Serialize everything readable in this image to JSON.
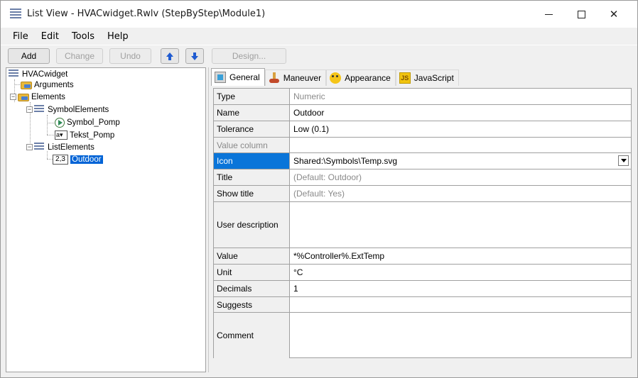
{
  "window": {
    "title": "List View - HVACwidget.Rwlv (StepByStep\\Module1)",
    "minimize_glyph": "—",
    "maximize_glyph": "☐",
    "close_glyph": "✕"
  },
  "menu": {
    "items": [
      {
        "label": "File"
      },
      {
        "label": "Edit"
      },
      {
        "label": "Tools"
      },
      {
        "label": "Help"
      }
    ]
  },
  "toolbar": {
    "add": "Add",
    "change": "Change",
    "undo": "Undo",
    "design": "Design...",
    "move_up_icon": "arrow-up-icon",
    "move_down_icon": "arrow-down-icon"
  },
  "tree": {
    "root": "HVACwidget",
    "arguments": "Arguments",
    "elements": "Elements",
    "symbol_elements": "SymbolElements",
    "symbol_pomp": "Symbol_Pomp",
    "tekst_pomp": "Tekst_Pomp",
    "list_elements": "ListElements",
    "outdoor": "Outdoor",
    "num_icon_text": "2,3",
    "textbox_icon_text": "a▾",
    "expander_minus": "−"
  },
  "tabs": [
    {
      "label": "General",
      "icon": "general-icon",
      "active": true
    },
    {
      "label": "Maneuver",
      "icon": "maneuver-icon",
      "active": false
    },
    {
      "label": "Appearance",
      "icon": "appearance-icon",
      "active": false
    },
    {
      "label": "JavaScript",
      "icon": "javascript-icon",
      "active": false
    }
  ],
  "properties": [
    {
      "key": "Type",
      "value": "Numeric",
      "value_grey": true
    },
    {
      "key": "Name",
      "value": "Outdoor"
    },
    {
      "key": "Tolerance",
      "value": "Low (0.1)"
    },
    {
      "key": "Value column",
      "value": "",
      "key_grey": true
    },
    {
      "key": "Icon",
      "value": "Shared:\\Symbols\\Temp.svg",
      "selected": true
    },
    {
      "key": "Title",
      "value": "(Default: Outdoor)",
      "value_grey": true
    },
    {
      "key": "Show title",
      "value": "(Default: Yes)",
      "value_grey": true
    },
    {
      "key": "User description",
      "value": ""
    },
    {
      "key": "Value",
      "value": "*%Controller%.ExtTemp"
    },
    {
      "key": "Unit",
      "value": "°C"
    },
    {
      "key": "Decimals",
      "value": "1"
    },
    {
      "key": "Suggests",
      "value": ""
    },
    {
      "key": "Comment",
      "value": ""
    }
  ],
  "colors": {
    "selection": "#0a75d9",
    "tree_selection": "#0063d6",
    "arrow_blue": "#1f5bd1"
  }
}
